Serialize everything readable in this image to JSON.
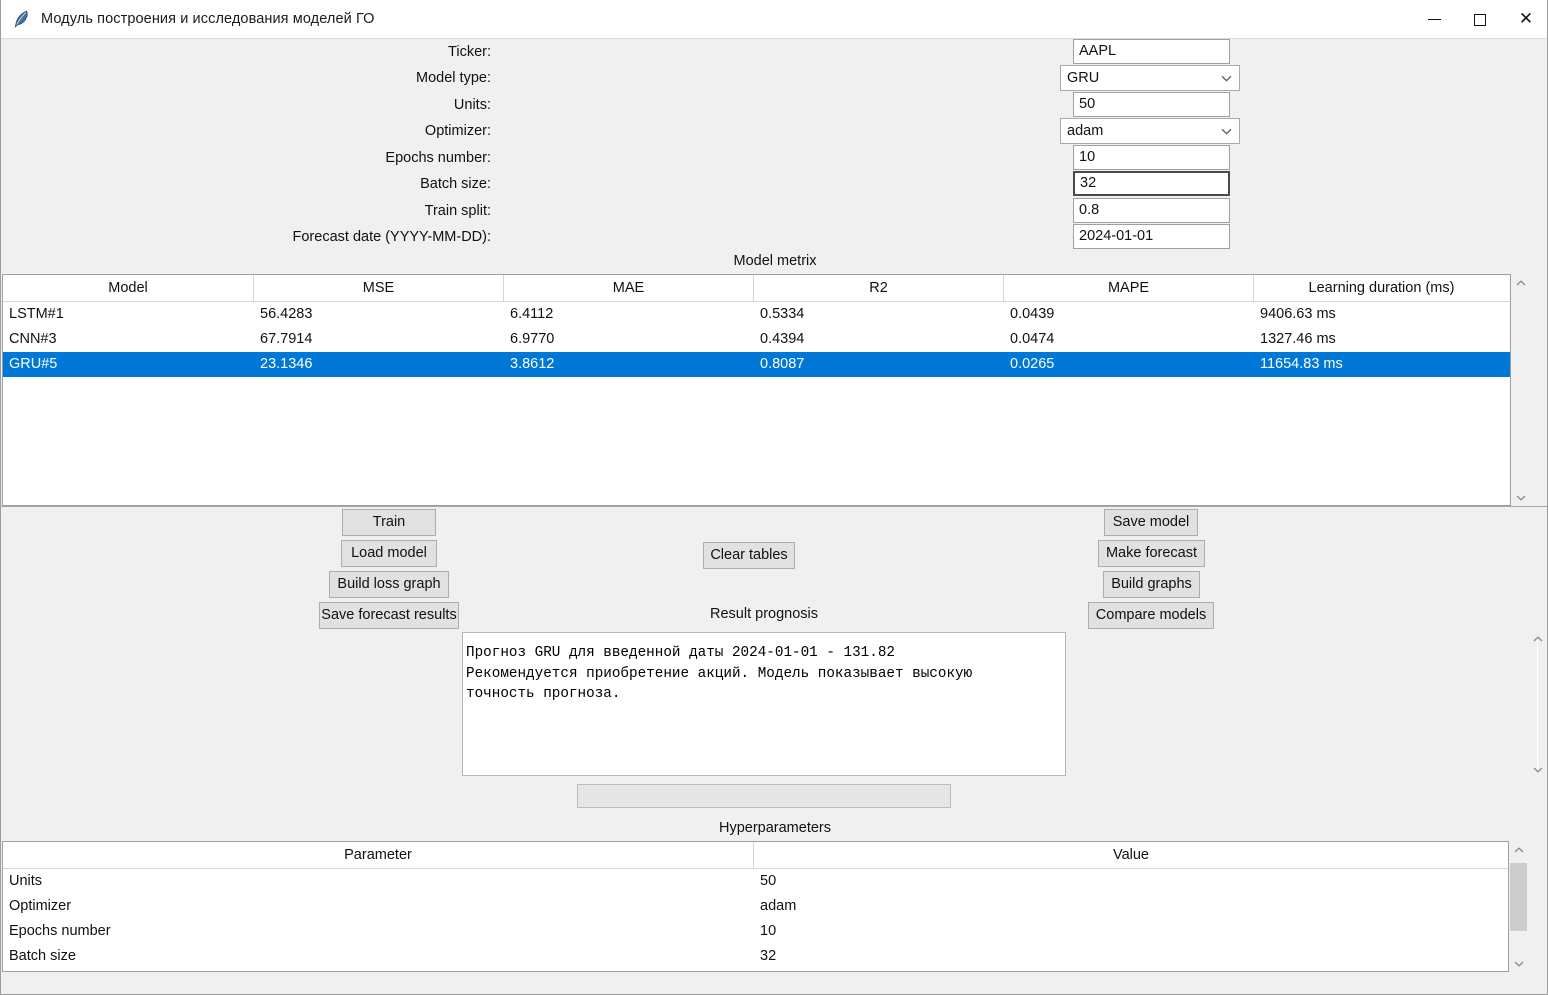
{
  "window": {
    "title": "Модуль построения и исследования моделей ГО",
    "icon": "feather-icon",
    "minimize_label": "—",
    "maximize_label": "",
    "close_label": "✕"
  },
  "form": {
    "fields": [
      {
        "label": "Ticker:",
        "value": "AAPL",
        "kind": "entry",
        "name": "ticker"
      },
      {
        "label": "Model type:",
        "value": "GRU",
        "kind": "combo",
        "name": "model-type"
      },
      {
        "label": "Units:",
        "value": "50",
        "kind": "entry",
        "name": "units"
      },
      {
        "label": "Optimizer:",
        "value": "adam",
        "kind": "combo",
        "name": "optimizer"
      },
      {
        "label": "Epochs number:",
        "value": "10",
        "kind": "entry",
        "name": "epochs-number"
      },
      {
        "label": "Batch size:",
        "value": "32",
        "kind": "entry",
        "name": "batch-size",
        "focused": true
      },
      {
        "label": "Train split:",
        "value": "0.8",
        "kind": "entry",
        "name": "train-split"
      },
      {
        "label": "Forecast date (YYYY-MM-DD):",
        "value": "2024-01-01",
        "kind": "entry",
        "name": "forecast-date"
      }
    ]
  },
  "metrics": {
    "caption": "Model metrix",
    "columns": [
      "Model",
      "MSE",
      "MAE",
      "R2",
      "MAPE",
      "Learning duration (ms)"
    ],
    "rows": [
      {
        "selected": false,
        "cells": [
          "LSTM#1",
          "56.4283",
          "6.4112",
          "0.5334",
          "0.0439",
          "9406.63 ms"
        ]
      },
      {
        "selected": false,
        "cells": [
          "CNN#3",
          "67.7914",
          "6.9770",
          "0.4394",
          "0.0474",
          "1327.46 ms"
        ]
      },
      {
        "selected": true,
        "cells": [
          "GRU#5",
          "23.1346",
          "3.8612",
          "0.8087",
          "0.0265",
          "11654.83 ms"
        ]
      }
    ]
  },
  "actions": {
    "left": [
      "Train",
      "Load model",
      "Build loss graph",
      "Save forecast results"
    ],
    "center": [
      "Clear tables"
    ],
    "right": [
      "Save model",
      "Make forecast",
      "Build graphs",
      "Compare models"
    ]
  },
  "prognosis": {
    "caption": "Result prognosis",
    "lines": [
      "Прогноз GRU для введенной даты 2024-01-01 - 131.82",
      "Рекомендуется приобретение акций. Модель показывает высокую",
      "точность прогноза."
    ]
  },
  "progress": {
    "value": 0
  },
  "hyperparameters": {
    "caption": "Hyperparameters",
    "columns": [
      "Parameter",
      "Value"
    ],
    "rows": [
      {
        "cells": [
          "Units",
          "50"
        ]
      },
      {
        "cells": [
          "Optimizer",
          "adam"
        ]
      },
      {
        "cells": [
          "Epochs number",
          "10"
        ]
      },
      {
        "cells": [
          "Batch size",
          "32"
        ]
      }
    ]
  },
  "colors": {
    "selection": "#0078d7",
    "window_bg": "#f0f0f0",
    "field_bg": "#ffffff",
    "button_bg": "#e1e1e1"
  }
}
